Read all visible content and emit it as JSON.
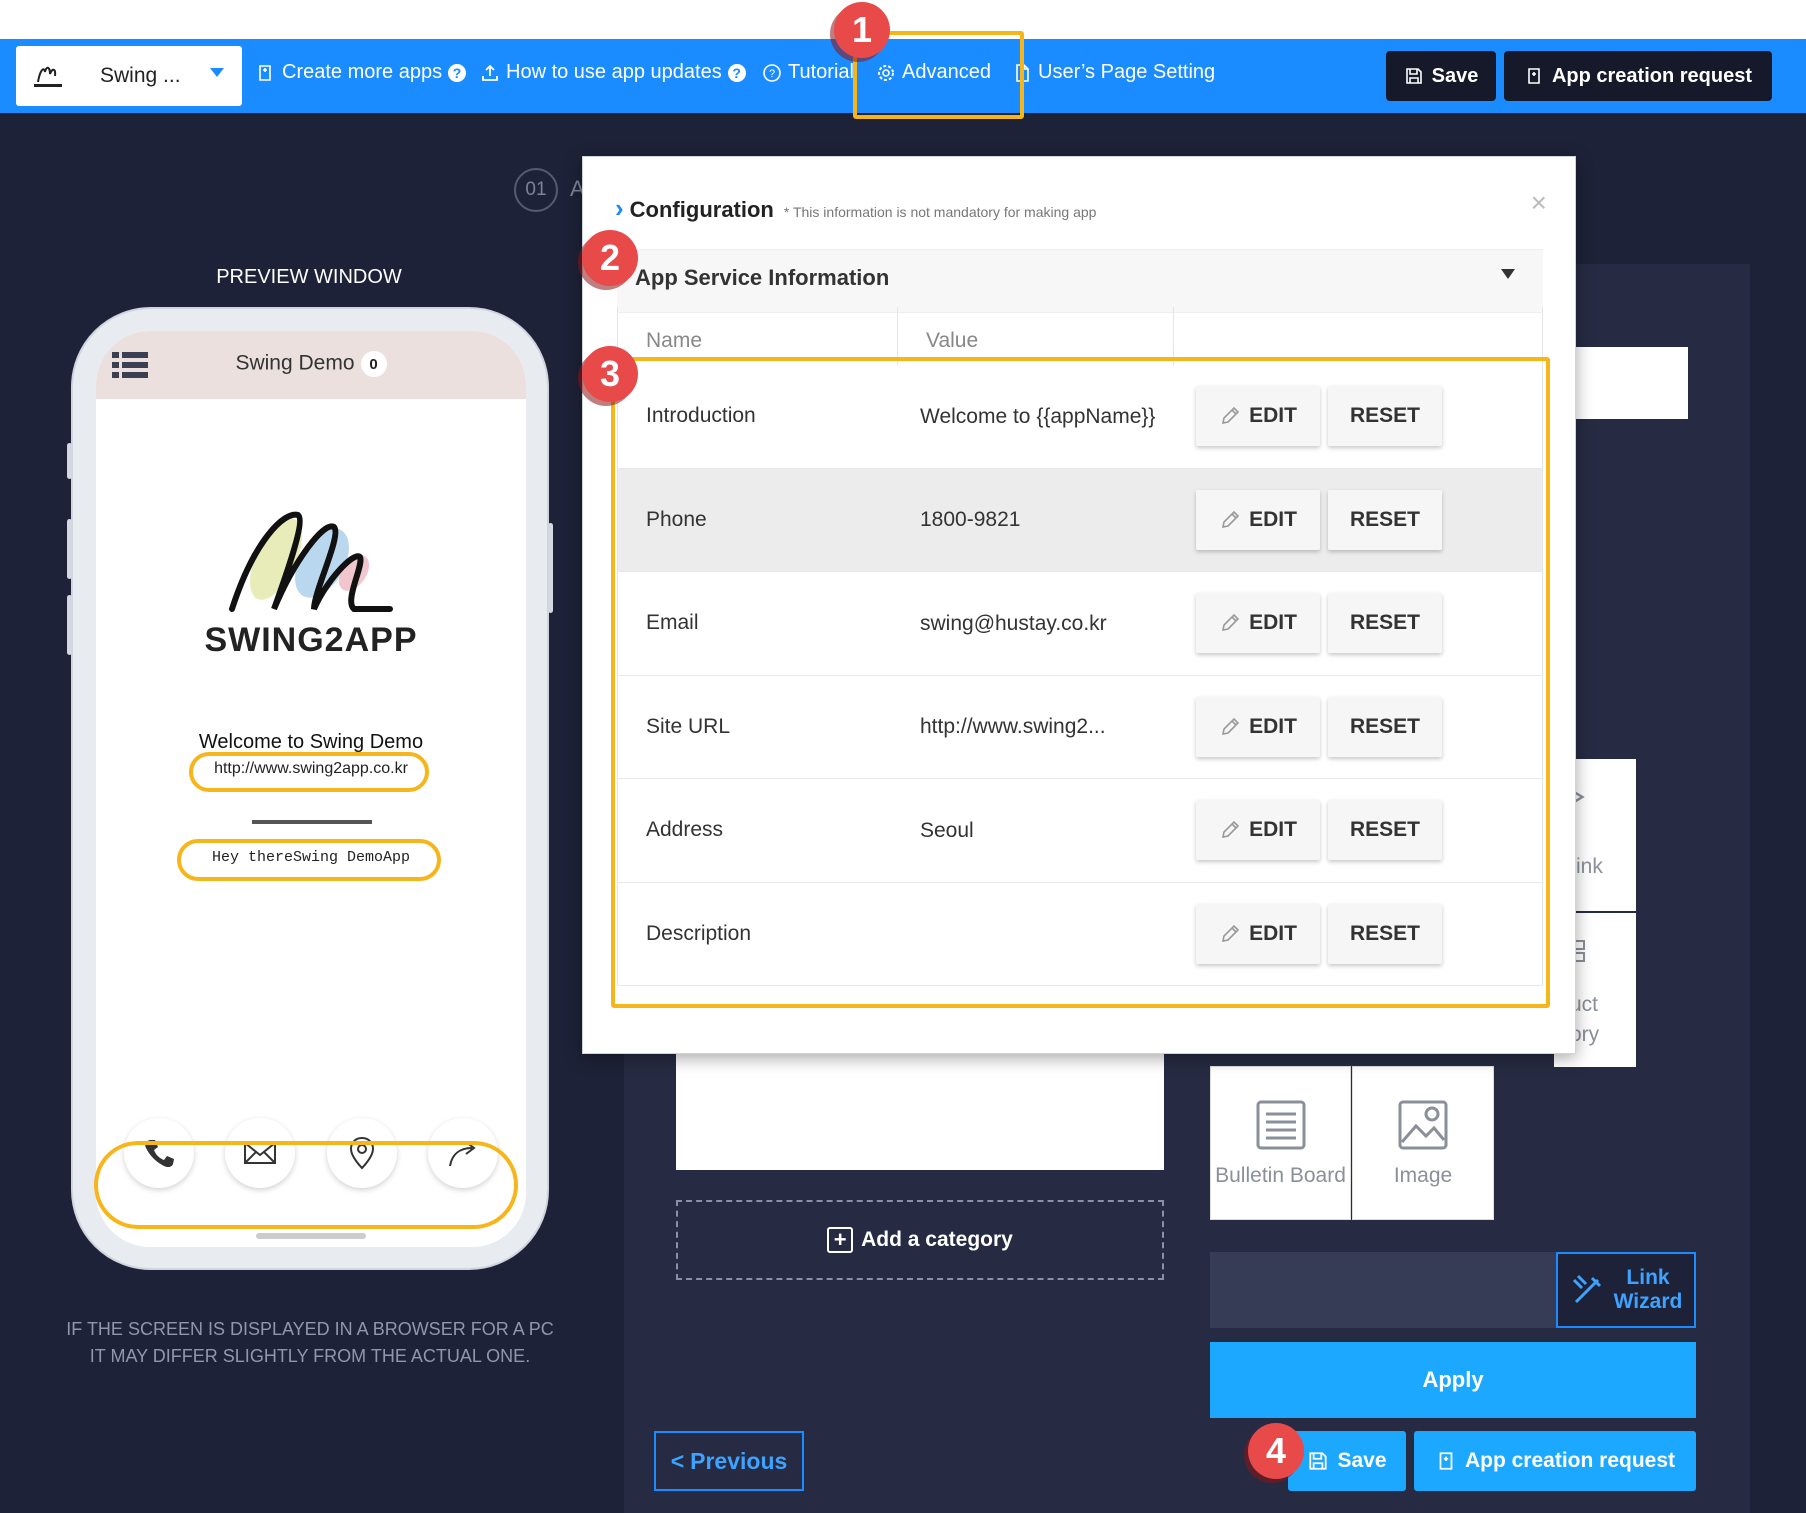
{
  "toolbar": {
    "app_name": "Swing ...",
    "nav": {
      "create_more_apps": "Create more apps",
      "how_to_use": "How to use app updates",
      "tutorial": "Tutorial",
      "advanced": "Advanced",
      "users_page_setting": "User’s Page Setting"
    },
    "save_label": "Save",
    "app_creation_request_label": "App creation request"
  },
  "markers": [
    "1",
    "2",
    "3",
    "4"
  ],
  "step": {
    "number": "01",
    "tail": "A"
  },
  "preview": {
    "title": "PREVIEW WINDOW",
    "app_title": "Swing Demo",
    "badge_count": "0",
    "logo_text": "SWING2APP",
    "welcome": "Welcome to Swing Demo",
    "site_url": "http://www.swing2app.co.kr",
    "hey_text": "Hey thereSwing DemoApp",
    "bottom_icons": [
      "phone-icon",
      "mail-icon",
      "location-icon",
      "share-icon"
    ],
    "disclaimer_line1": "IF THE SCREEN IS DISPLAYED IN A BROWSER FOR A PC",
    "disclaimer_line2": "IT MAY DIFFER SLIGHTLY FROM THE ACTUAL ONE."
  },
  "modal": {
    "title": "Configuration",
    "note": "* This information is not mandatory for making app",
    "section_title": "App Service Information",
    "columns": [
      "Name",
      "Value",
      ""
    ],
    "rows": [
      {
        "name": "Introduction",
        "value": "Welcome to {{appName}}"
      },
      {
        "name": "Phone",
        "value": "1800-9821"
      },
      {
        "name": "Email",
        "value": "swing@hustay.co.kr"
      },
      {
        "name": "Site URL",
        "value": "http://www.swing2..."
      },
      {
        "name": "Address",
        "value": "Seoul"
      },
      {
        "name": "Description",
        "value": ""
      }
    ],
    "edit_label": "EDIT",
    "reset_label": "RESET"
  },
  "background": {
    "add_category": "Add a category",
    "tile_link_partial": "ink",
    "tile_product_partial_1": "uct",
    "tile_product_partial_2": "ory",
    "tile_bulletin": "Bulletin Board",
    "tile_image": "Image",
    "link_wizard_line1": "Link",
    "link_wizard_line2": "Wizard",
    "apply_label": "Apply",
    "previous_label": "Previous",
    "save_label": "Save",
    "app_creation_request_label": "App creation request"
  },
  "colors": {
    "toolbar_blue": "#1a8cff",
    "highlight": "#f7b51c",
    "marker_red": "#e84a4a",
    "dark_bg": "#1e2238"
  }
}
